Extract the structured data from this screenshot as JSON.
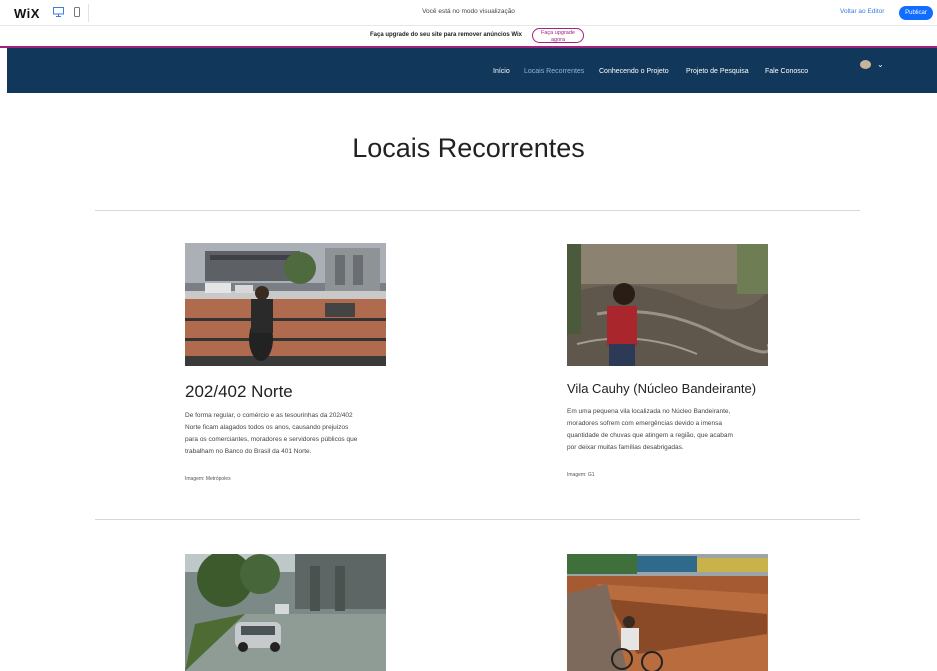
{
  "wix": {
    "logo": "WiX",
    "preview_text": "Você está no modo visualização",
    "back_to_editor": "Voltar ao Editor",
    "publish": "Publicar"
  },
  "upgrade": {
    "text": "Faça upgrade do seu site para remover anúncios Wix",
    "button_line1": "Faça upgrade",
    "button_line2": "agora"
  },
  "nav": {
    "items": [
      "Início",
      "Locais Recorrentes",
      "Conhecendo o Projeto",
      "Projeto de Pesquisa",
      "Fale Conosco"
    ],
    "active_index": 1
  },
  "page": {
    "title": "Locais Recorrentes"
  },
  "items": [
    {
      "title": "202/402 Norte",
      "desc": [
        "De forma regular, o comércio e as tesourinhas da 202/402",
        "Norte ficam alagados todos os anos, causando prejuizos",
        "para os comerciantes, moradores e servidores públicos que",
        "trabalham no Banco do Brasil da 401 Norte."
      ],
      "credit": "Imagem: Metrópoles"
    },
    {
      "title": "Vila Cauhy (Núcleo Bandeirante)",
      "desc": [
        "Em uma pequena vila localizada no Núcleo Bandeirante,",
        "moradores sofrem com emergências devido a imensa",
        "quantidade de chuvas que atingem a região, que acabam",
        "por deixar muitas famílias desabrigadas."
      ],
      "credit": "Imagem: G1"
    }
  ],
  "colors": {
    "header": "#11375a",
    "upgrade_accent": "#a3227e",
    "publish": "#116dff"
  }
}
